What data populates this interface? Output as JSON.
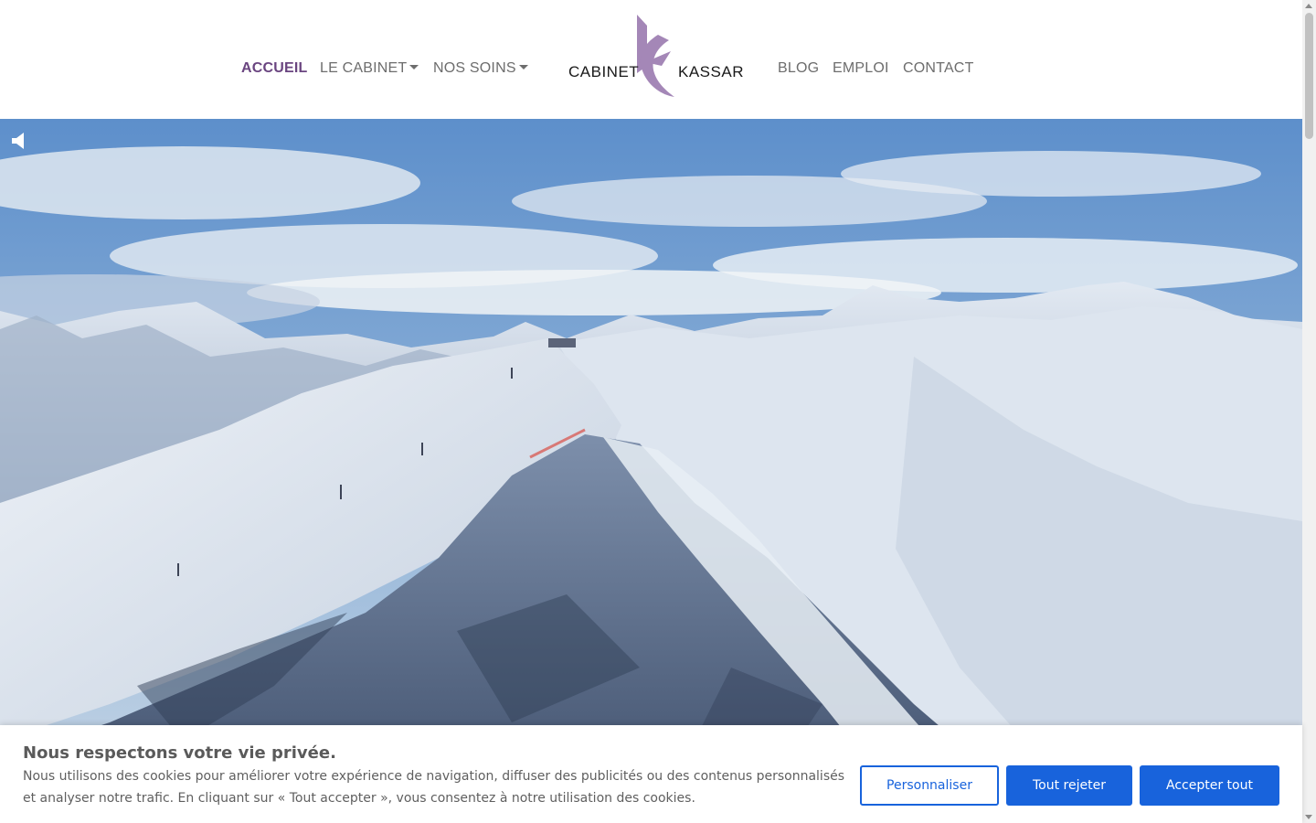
{
  "nav": {
    "items": [
      {
        "label": "ACCUEIL",
        "active": true
      },
      {
        "label": "LE CABINET",
        "dropdown": true
      },
      {
        "label": "NOS SOINS",
        "dropdown": true
      },
      {
        "label": "BLOG"
      },
      {
        "label": "EMPLOI"
      },
      {
        "label": "CONTACT"
      }
    ]
  },
  "logo": {
    "word_left": "CABINET",
    "word_right": "KASSAR",
    "color": "#a487b7"
  },
  "hero": {
    "media": "mountain-video",
    "sound_icon": "speaker-muted-icon"
  },
  "cookie": {
    "title": "Nous respectons votre vie privée.",
    "text": "Nous utilisons des cookies pour améliorer votre expérience de navigation, diffuser des publicités ou des contenus personnalisés et analyser notre trafic. En cliquant sur « Tout accepter », vous consentez à notre utilisation des cookies.",
    "customize_label": "Personnaliser",
    "reject_label": "Tout rejeter",
    "accept_label": "Accepter tout",
    "accent_color": "#1863dc"
  },
  "colors": {
    "nav_active": "#6a4580",
    "nav_text": "#6d6d6d"
  }
}
